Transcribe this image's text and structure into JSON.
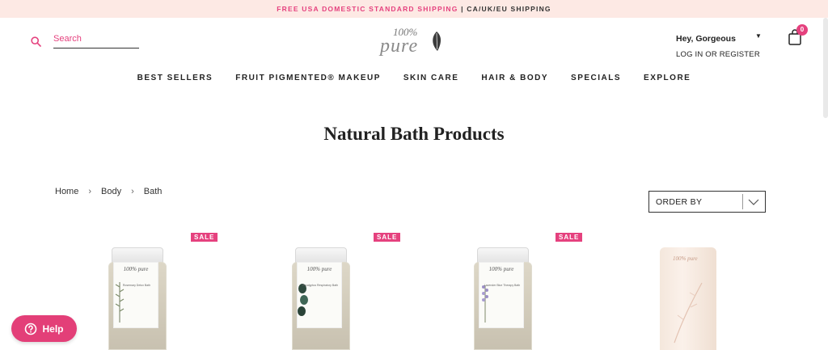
{
  "announcement": {
    "highlight": "FREE USA DOMESTIC STANDARD SHIPPING",
    "separator": " | ",
    "rest": "CA/UK/EU SHIPPING"
  },
  "search": {
    "placeholder": "Search",
    "icon": "search-icon"
  },
  "logo": {
    "top": "100%",
    "main": "pure"
  },
  "account": {
    "greeting": "Hey, Gorgeous",
    "caret": "▼",
    "login": "LOG IN OR REGISTER"
  },
  "cart": {
    "count": "0",
    "icon": "shopping-bag-icon"
  },
  "nav": {
    "items": [
      "BEST SELLERS",
      "FRUIT PIGMENTED® MAKEUP",
      "SKIN CARE",
      "HAIR & BODY",
      "SPECIALS",
      "EXPLORE"
    ]
  },
  "page": {
    "title": "Natural Bath Products"
  },
  "breadcrumb": {
    "items": [
      "Home",
      "Body",
      "Bath"
    ],
    "separator": "›"
  },
  "sort": {
    "label": "ORDER BY"
  },
  "products": [
    {
      "badge": "SALE",
      "brand": "100% pure",
      "name": "Rosemary Detox Bath"
    },
    {
      "badge": "SALE",
      "brand": "100% pure",
      "name": "Eucalyptus Respiratory Bath"
    },
    {
      "badge": "SALE",
      "brand": "100% pure",
      "name": "Lavender Blue Therapy Bath"
    },
    {
      "badge": "",
      "brand": "100% pure",
      "name": ""
    }
  ],
  "help": {
    "label": "Help"
  },
  "colors": {
    "accent": "#e5417e",
    "announcement_bg": "#fde9e4",
    "help_bg": "#e33f78"
  }
}
